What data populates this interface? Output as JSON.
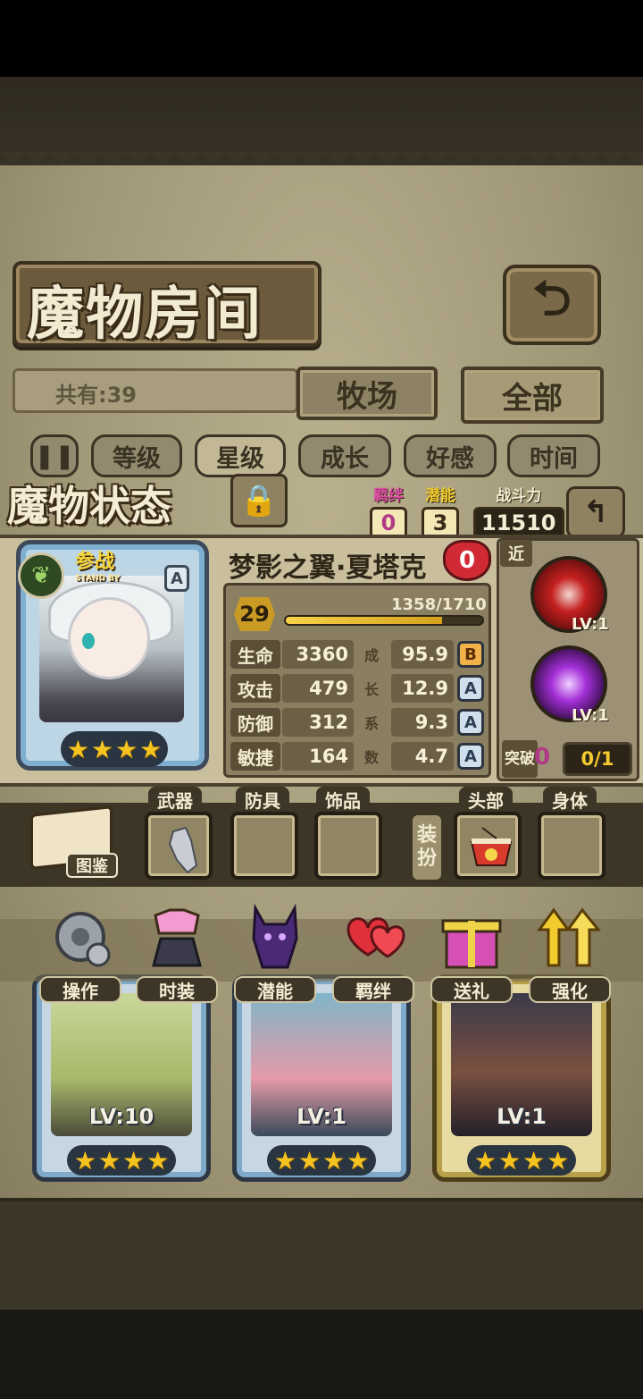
{
  "header": {
    "title": "魔物房间",
    "back_icon": "return-icon"
  },
  "collection": {
    "count_text": "共有:39"
  },
  "tabs": [
    {
      "label": "牧场",
      "selected": false
    },
    {
      "label": "全部",
      "selected": true
    }
  ],
  "sort": {
    "toggle_icon": "pause-icon",
    "options": [
      "等级",
      "星级",
      "成长",
      "好感",
      "时间"
    ],
    "selected": "星级"
  },
  "status": {
    "title": "魔物状态",
    "lock_icon": "lock-icon",
    "bond_label": "羁绊",
    "bond_value": "0",
    "potential_label": "潜能",
    "potential_value": "3",
    "power_label": "战斗力",
    "power_value": "11510",
    "back_icon": "return-icon"
  },
  "monster": {
    "name": "梦影之翼·夏塔克",
    "affection": "0",
    "standby_label": "参战",
    "standby_sub": "STAND BY",
    "element_icon": "leaf-icon",
    "rank": "A",
    "star_count": 4,
    "level": "29",
    "exp_text": "1358/1710",
    "exp_current": 1358,
    "exp_max": 1710,
    "growth_chars": [
      "成",
      "长",
      "系",
      "数"
    ],
    "stats": [
      {
        "name": "生命",
        "value": "3360",
        "growth": "95.9",
        "grade": "B"
      },
      {
        "name": "攻击",
        "value": "479",
        "growth": "12.9",
        "grade": "A"
      },
      {
        "name": "防御",
        "value": "312",
        "growth": "9.3",
        "grade": "A"
      },
      {
        "name": "敏捷",
        "value": "164",
        "growth": "4.7",
        "grade": "A"
      }
    ],
    "range_label": "近",
    "skills": [
      {
        "icon": "claw-slash-icon",
        "level": "LV:1"
      },
      {
        "icon": "purple-spiral-icon",
        "level": "LV:1"
      }
    ],
    "breakthrough_label": "突破",
    "breakthrough_value": "0",
    "breakthrough_progress": "0/1"
  },
  "equipment": {
    "guide_label": "图鉴",
    "guide_icon": "book-icon",
    "slots": [
      {
        "label": "武器",
        "icon": "statue-item-icon",
        "filled": true
      },
      {
        "label": "防具",
        "icon": "",
        "filled": false
      },
      {
        "label": "饰品",
        "icon": "",
        "filled": false
      }
    ],
    "outfit_label": "装扮",
    "outfit_slots": [
      {
        "label": "头部",
        "icon": "noodle-bowl-icon",
        "filled": true
      },
      {
        "label": "身体",
        "icon": "",
        "filled": false
      }
    ]
  },
  "actions": [
    {
      "label": "操作",
      "icon": "gear-icon"
    },
    {
      "label": "时装",
      "icon": "outfit-icon"
    },
    {
      "label": "潜能",
      "icon": "demon-silhouette-icon"
    },
    {
      "label": "羁绊",
      "icon": "hearts-icon"
    },
    {
      "label": "送礼",
      "icon": "gift-icon"
    },
    {
      "label": "强化",
      "icon": "up-arrows-icon"
    }
  ],
  "monster_cards": [
    {
      "level": "LV:10",
      "stars": 4,
      "frame": "blue"
    },
    {
      "level": "LV:1",
      "stars": 4,
      "frame": "blue"
    },
    {
      "level": "LV:1",
      "stars": 4,
      "frame": "gold"
    }
  ],
  "colors": {
    "accent_gold": "#f3cb2f",
    "bond_pink": "#e04fa5",
    "heart_red": "#d22a35",
    "parchment": "#c9bf9c"
  }
}
